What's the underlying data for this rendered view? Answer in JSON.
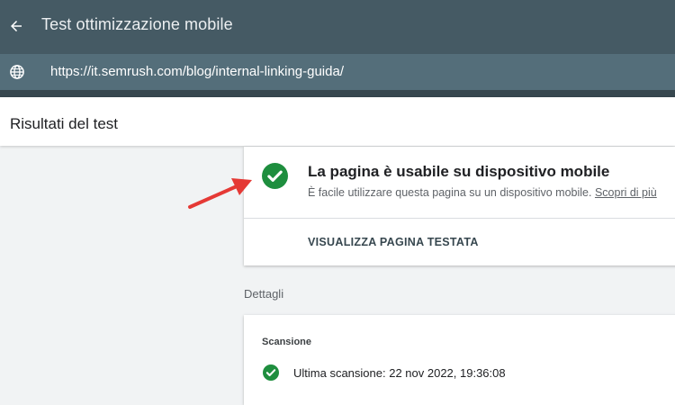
{
  "header": {
    "back_icon": "arrow-back-icon",
    "title": "Test ottimizzazione mobile"
  },
  "url_bar": {
    "icon": "globe-icon",
    "url": "https://it.semrush.com/blog/internal-linking-guida/"
  },
  "results": {
    "title": "Risultati del test"
  },
  "result_card": {
    "status_icon": "check-circle-icon",
    "status_color": "#1e8e3e",
    "heading": "La pagina è usabile su dispositivo mobile",
    "description": "È facile utilizzare questa pagina su un dispositivo mobile.",
    "learn_more": "Scopri di più",
    "view_button": "VISUALIZZA PAGINA TESTATA"
  },
  "details": {
    "label": "Dettagli",
    "scan_section": {
      "title": "Scansione",
      "status_icon": "check-circle-icon",
      "last_scan": "Ultima scansione: 22 nov 2022, 19:36:08"
    }
  },
  "annotation": {
    "icon": "red-arrow-icon",
    "color": "#e53935"
  },
  "colors": {
    "header_bg": "#455a64",
    "urlbar_bg": "#546e7a",
    "success": "#1e8e3e"
  }
}
